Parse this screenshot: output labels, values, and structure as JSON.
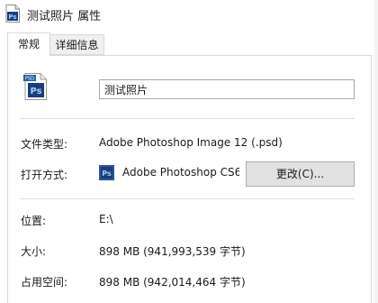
{
  "window": {
    "title": "测试照片 属性",
    "title_icon": "psd-file-icon"
  },
  "tabs": [
    {
      "label": "常规",
      "active": true
    },
    {
      "label": "详细信息",
      "active": false
    }
  ],
  "general": {
    "file_icon": "psd-file-icon",
    "file_icon_badge": "PSD",
    "file_icon_letters": "Ps",
    "file_name": "测试照片",
    "file_type_label": "文件类型:",
    "file_type_value": "Adobe Photoshop Image 12 (.psd)",
    "opens_with_label": "打开方式:",
    "opens_with_icon": "photoshop-app-icon",
    "opens_with_icon_letters": "Ps",
    "opens_with_value": "Adobe Photoshop CS6",
    "change_button_label": "更改(C)...",
    "location_label": "位置:",
    "location_value": "E:\\",
    "size_label": "大小:",
    "size_value": "898 MB (941,993,539 字节)",
    "size_on_disk_label": "占用空间:",
    "size_on_disk_value": "898 MB (942,014,464 字节)"
  },
  "colors": {
    "photoshop_blue": "#1c3c7a",
    "photoshop_text": "#9fd0ff",
    "button_face": "#e1e1e1",
    "border": "#d9d9d9"
  }
}
